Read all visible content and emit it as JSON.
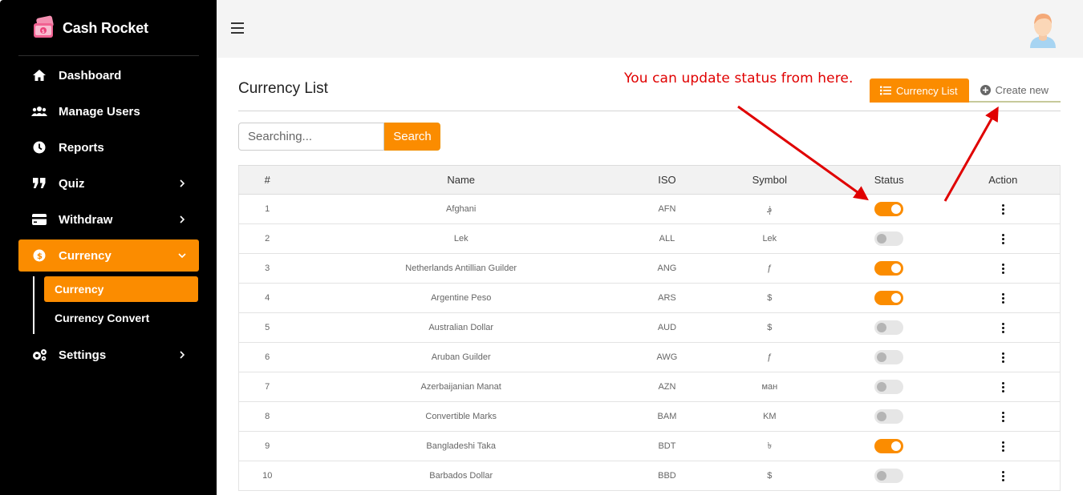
{
  "brand": {
    "name": "Cash Rocket"
  },
  "sidebar": {
    "items": [
      {
        "label": "Dashboard",
        "icon": "home-icon"
      },
      {
        "label": "Manage Users",
        "icon": "users-icon"
      },
      {
        "label": "Reports",
        "icon": "clock-icon"
      },
      {
        "label": "Quiz",
        "icon": "quote-icon",
        "expandable": true
      },
      {
        "label": "Withdraw",
        "icon": "card-icon",
        "expandable": true
      },
      {
        "label": "Currency",
        "icon": "dollar-circle-icon",
        "expandable": true,
        "active": true
      },
      {
        "label": "Settings",
        "icon": "gears-icon",
        "expandable": true
      }
    ],
    "currency_sub": [
      {
        "label": "Currency",
        "active": true
      },
      {
        "label": "Currency Convert",
        "active": false
      }
    ]
  },
  "page": {
    "title": "Currency List",
    "annotation": "You can update status from here.",
    "tabs": {
      "list": "Currency List",
      "create": "Create new"
    }
  },
  "search": {
    "placeholder": "Searching...",
    "button": "Search"
  },
  "table": {
    "headers": [
      "#",
      "Name",
      "ISO",
      "Symbol",
      "Status",
      "Action"
    ],
    "rows": [
      {
        "num": "1",
        "name": "Afghani",
        "iso": "AFN",
        "symbol": "؋",
        "status": true
      },
      {
        "num": "2",
        "name": "Lek",
        "iso": "ALL",
        "symbol": "Lek",
        "status": false
      },
      {
        "num": "3",
        "name": "Netherlands Antillian Guilder",
        "iso": "ANG",
        "symbol": "ƒ",
        "status": true
      },
      {
        "num": "4",
        "name": "Argentine Peso",
        "iso": "ARS",
        "symbol": "$",
        "status": true
      },
      {
        "num": "5",
        "name": "Australian Dollar",
        "iso": "AUD",
        "symbol": "$",
        "status": false
      },
      {
        "num": "6",
        "name": "Aruban Guilder",
        "iso": "AWG",
        "symbol": "ƒ",
        "status": false
      },
      {
        "num": "7",
        "name": "Azerbaijanian Manat",
        "iso": "AZN",
        "symbol": "ман",
        "status": false
      },
      {
        "num": "8",
        "name": "Convertible Marks",
        "iso": "BAM",
        "symbol": "KM",
        "status": false
      },
      {
        "num": "9",
        "name": "Bangladeshi Taka",
        "iso": "BDT",
        "symbol": "৳",
        "status": true
      },
      {
        "num": "10",
        "name": "Barbados Dollar",
        "iso": "BBD",
        "symbol": "$",
        "status": false
      }
    ]
  },
  "colors": {
    "accent": "#fb8c00",
    "sidebar_bg": "#000000",
    "annotation": "#e00000"
  }
}
